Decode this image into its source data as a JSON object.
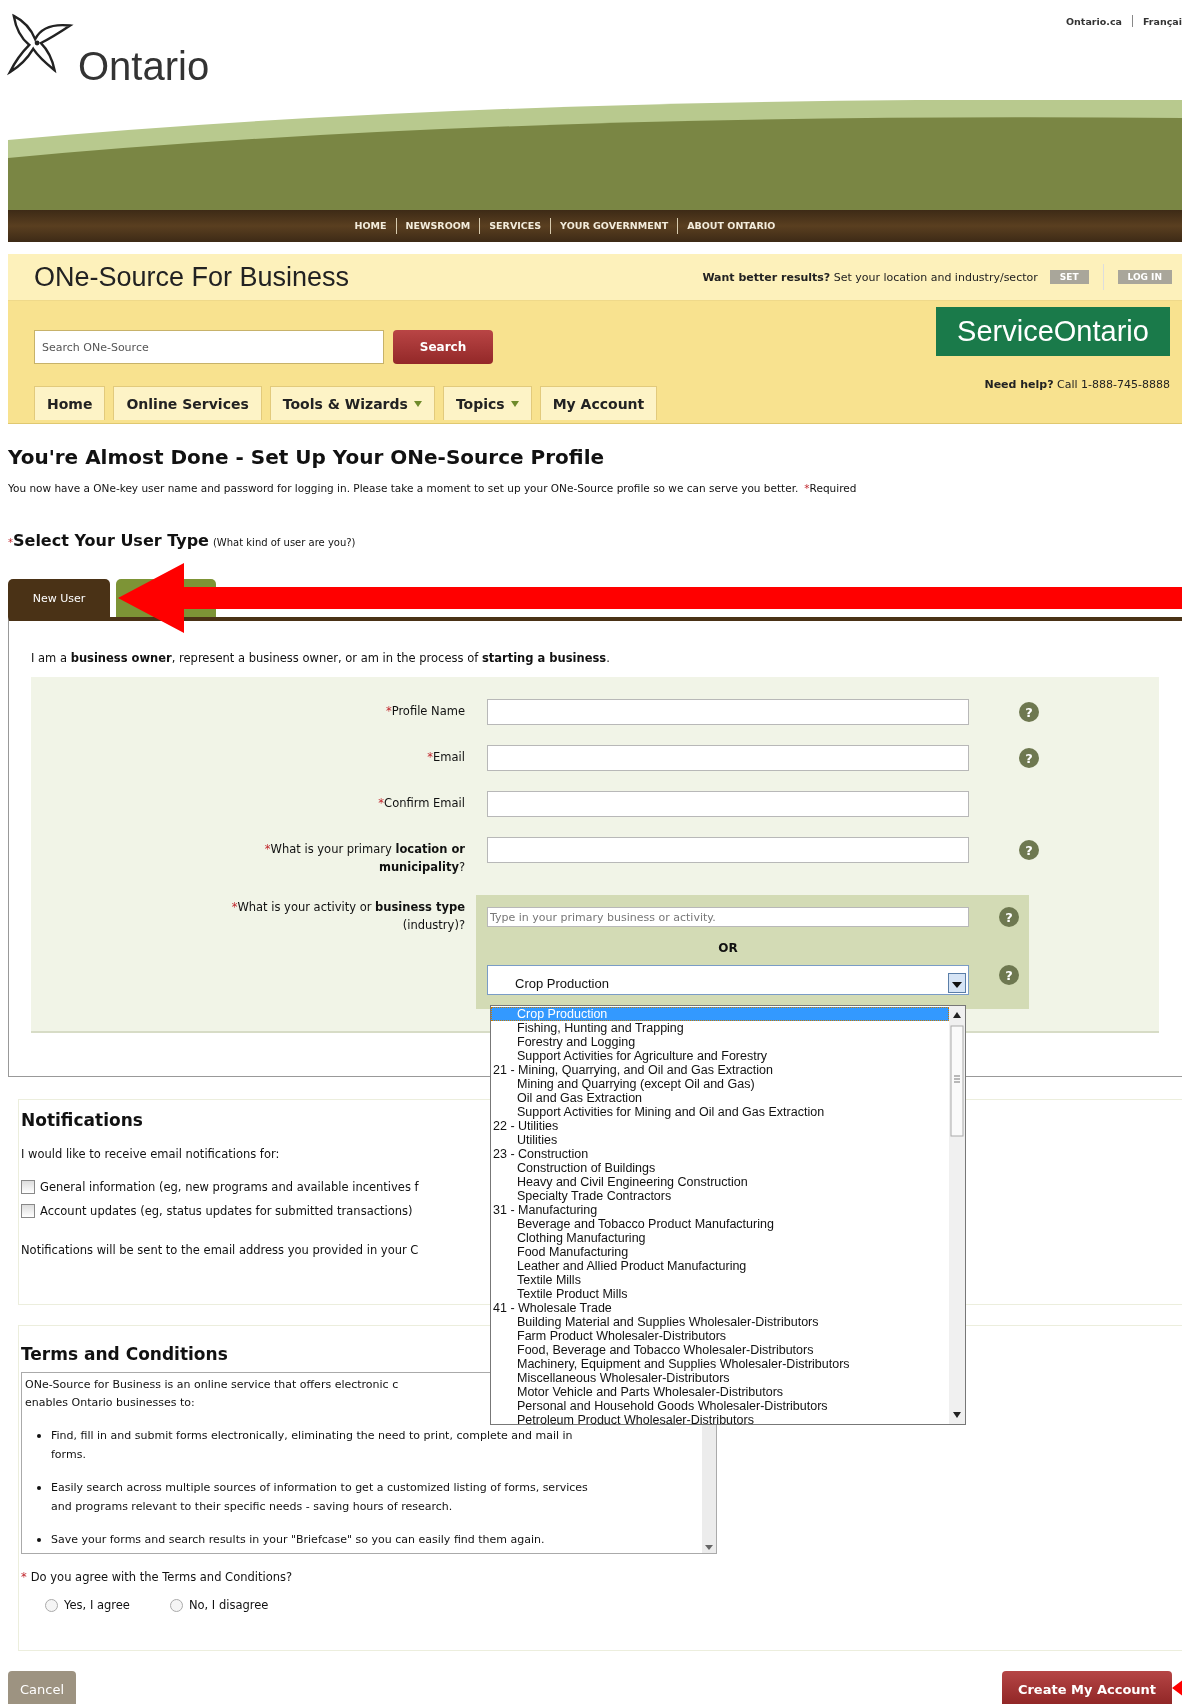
{
  "header": {
    "logo": "Ontario",
    "links": [
      "Ontario.ca",
      "Françai"
    ]
  },
  "nav": [
    "HOME",
    "NEWSROOM",
    "SERVICES",
    "YOUR GOVERNMENT",
    "ABOUT ONTARIO"
  ],
  "site": {
    "title": "ONe-Source For Business",
    "results": "**Want better results?** Set your location and industry/sector",
    "set_button": "SET",
    "login_button": "LOG IN"
  },
  "search": {
    "placeholder": "Search ONe-Source",
    "button": "Search"
  },
  "brand": "ServiceOntario",
  "help_line": "**Need help?** Call 1-888-745-8888",
  "menu": [
    {
      "label": "Home",
      "dropdown": false
    },
    {
      "label": "Online Services",
      "dropdown": false
    },
    {
      "label": "Tools & Wizards",
      "dropdown": true
    },
    {
      "label": "Topics",
      "dropdown": true
    },
    {
      "label": "My Account",
      "dropdown": false
    }
  ],
  "page": {
    "title": "You're Almost Done - Set Up Your ONe-Source Profile",
    "description": "You now have a ONe-key user name and password for logging in. Please take a moment to set up your ONe-Source profile so we can serve you better.",
    "required_mark": "*",
    "required_note": "Required"
  },
  "user_type": {
    "mark": "*",
    "title": "Select Your User Type",
    "hint": "(What kind of user are you?)"
  },
  "tabs": [
    {
      "label": "New User",
      "selected": true
    },
    {
      "selected": false
    }
  ],
  "intro": "I am a **business owner**, represent a business owner, or am in the process of **starting a business**.",
  "fields": [
    {
      "mark": "*",
      "label": "Profile Name",
      "help": "?"
    },
    {
      "mark": "*",
      "label": "Email",
      "help": "?"
    },
    {
      "mark": "*",
      "label": "Confirm Email"
    },
    {
      "mark": "*",
      "label": "What is your primary **location or municipality**?",
      "help": "?"
    }
  ],
  "business": {
    "mark": "*",
    "label": "What is your activity or **business type**",
    "sublabel": "(industry)?",
    "placeholder": "Type in your primary business or activity.",
    "help": "?",
    "or": "OR",
    "select_value": "Crop Production",
    "select_help": "?",
    "options": [
      {
        "kind": "option",
        "label": "Crop Production",
        "selected": true
      },
      {
        "kind": "option",
        "label": "Fishing, Hunting and Trapping",
        "selected": false
      },
      {
        "kind": "option",
        "label": "Forestry and Logging",
        "selected": false
      },
      {
        "kind": "option",
        "label": "Support Activities for Agriculture and Forestry",
        "selected": false
      },
      {
        "kind": "sector",
        "label": "21 - Mining, Quarrying, and Oil and Gas Extraction",
        "selected": false
      },
      {
        "kind": "option",
        "label": "Mining and Quarrying (except Oil and Gas)",
        "selected": false
      },
      {
        "kind": "option",
        "label": "Oil and Gas Extraction",
        "selected": false
      },
      {
        "kind": "option",
        "label": "Support Activities for Mining and Oil and Gas Extraction",
        "selected": false
      },
      {
        "kind": "sector",
        "label": "22 - Utilities",
        "selected": false
      },
      {
        "kind": "option",
        "label": "Utilities",
        "selected": false
      },
      {
        "kind": "sector",
        "label": "23 - Construction",
        "selected": false
      },
      {
        "kind": "option",
        "label": "Construction of Buildings",
        "selected": false
      },
      {
        "kind": "option",
        "label": "Heavy and Civil Engineering Construction",
        "selected": false
      },
      {
        "kind": "option",
        "label": "Specialty Trade Contractors",
        "selected": false
      },
      {
        "kind": "sector",
        "label": "31 - Manufacturing",
        "selected": false
      },
      {
        "kind": "option",
        "label": "Beverage and Tobacco Product Manufacturing",
        "selected": false
      },
      {
        "kind": "option",
        "label": "Clothing Manufacturing",
        "selected": false
      },
      {
        "kind": "option",
        "label": "Food Manufacturing",
        "selected": false
      },
      {
        "kind": "option",
        "label": "Leather and Allied Product Manufacturing",
        "selected": false
      },
      {
        "kind": "option",
        "label": "Textile Mills",
        "selected": false
      },
      {
        "kind": "option",
        "label": "Textile Product Mills",
        "selected": false
      },
      {
        "kind": "sector",
        "label": "41 - Wholesale Trade",
        "selected": false
      },
      {
        "kind": "option",
        "label": "Building Material and Supplies Wholesaler-Distributors",
        "selected": false
      },
      {
        "kind": "option",
        "label": "Farm Product Wholesaler-Distributors",
        "selected": false
      },
      {
        "kind": "option",
        "label": "Food, Beverage and Tobacco Wholesaler-Distributors",
        "selected": false
      },
      {
        "kind": "option",
        "label": "Machinery, Equipment and Supplies Wholesaler-Distributors",
        "selected": false
      },
      {
        "kind": "option",
        "label": "Miscellaneous Wholesaler-Distributors",
        "selected": false
      },
      {
        "kind": "option",
        "label": "Motor Vehicle and Parts Wholesaler-Distributors",
        "selected": false
      },
      {
        "kind": "option",
        "label": "Personal and Household Goods Wholesaler-Distributors",
        "selected": false
      },
      {
        "kind": "option",
        "label": "Petroleum Product Wholesaler-Distributors",
        "selected": false
      }
    ]
  },
  "notifications": {
    "title": "Notifications",
    "intro": "I would like to receive email notifications for:",
    "options": [
      {
        "label": "General information (eg, new programs and available incentives f",
        "checked": false
      },
      {
        "label": "Account updates (eg, status updates for submitted transactions)",
        "checked": false
      }
    ],
    "note": "Notifications will be sent to the email address you provided in your C"
  },
  "terms": {
    "title": "Terms and Conditions",
    "lines": [
      "ONe-Source for Business is an online service that offers electronic c",
      "enables Ontario businesses to:"
    ],
    "bullets": [
      "Find, fill in and submit forms electronically, eliminating the need to print, complete and mail in forms.",
      "Easily search across multiple sources of information to get a customized listing of forms, services and programs relevant to their specific needs - saving hours of research.",
      "Save your forms and search results in your \"Briefcase\" so you can easily find them again."
    ],
    "question_mark": "*",
    "question": "Do you agree with the Terms and Conditions?",
    "choices": [
      {
        "label": "Yes, I agree",
        "selected": false
      },
      {
        "label": "No, I disagree",
        "selected": false
      }
    ]
  },
  "buttons": [
    {
      "label": "Cancel",
      "kind": "secondary"
    },
    {
      "label": "Create My Account",
      "kind": "primary"
    }
  ]
}
